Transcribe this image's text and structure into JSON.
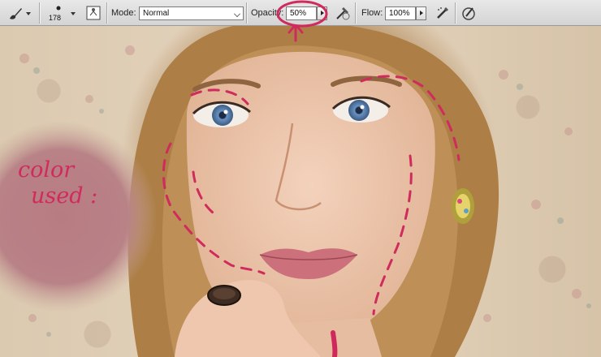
{
  "toolbar": {
    "brush_size": "178",
    "mode_label": "Mode:",
    "mode_value": "Normal",
    "opacity_label": "Opacity:",
    "opacity_value": "50%",
    "flow_label": "Flow:",
    "flow_value": "100%"
  },
  "annotation": {
    "line1": "color",
    "line2": "used :",
    "swatch_color": "#b77c82",
    "ink_color": "#cf2b5d"
  }
}
